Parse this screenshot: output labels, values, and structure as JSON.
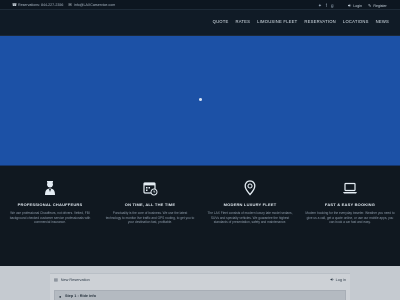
{
  "topbar": {
    "phone_label": "Reservations: 844-227-2356",
    "email_label": "info@LAXCarservice.com",
    "social": [
      "twitter-icon",
      "facebook-icon",
      "google-plus-icon"
    ],
    "login_label": "Login",
    "register_label": "Register"
  },
  "nav": {
    "items": [
      "QUOTE",
      "RATES",
      "LIMOUSINE FLEET",
      "RESERVATION",
      "LOCATIONS",
      "NEWS"
    ]
  },
  "hero": {
    "color": "#1c51a6"
  },
  "features": [
    {
      "icon": "chauffeur-icon",
      "title": "PROFESSIONAL CHAUFFEURS",
      "desc": "We use professional Chauffeurs, not drivers. Vetted, FBI background checked customer service professionals with commercial insurance."
    },
    {
      "icon": "calendar-clock-icon",
      "title": "ON TIME, ALL THE TIME",
      "desc": "Punctuality is the core of business. We use the latest technology to monitor live traffic and GPS routing, to get you to your destination fast, profitable."
    },
    {
      "icon": "map-pin-icon",
      "title": "MODERN LUXURY FLEET",
      "desc": "The LAX Fleet consists of modern luxury late model sedans, SUVs and specialty vehicles. We guarantee the highest standards of presentation, safety and maintenance."
    },
    {
      "icon": "laptop-icon",
      "title": "FAST & EASY BOOKING",
      "desc": "Modern booking for the everyday traveler. Weather you need to give us a call, get a quote online, or use our mobile apps, you can book a car fast and easy."
    }
  ],
  "booking": {
    "new_reservation_label": "New Reservation",
    "login_label": "Log in",
    "step_label": "Step 1 : Ride info"
  }
}
